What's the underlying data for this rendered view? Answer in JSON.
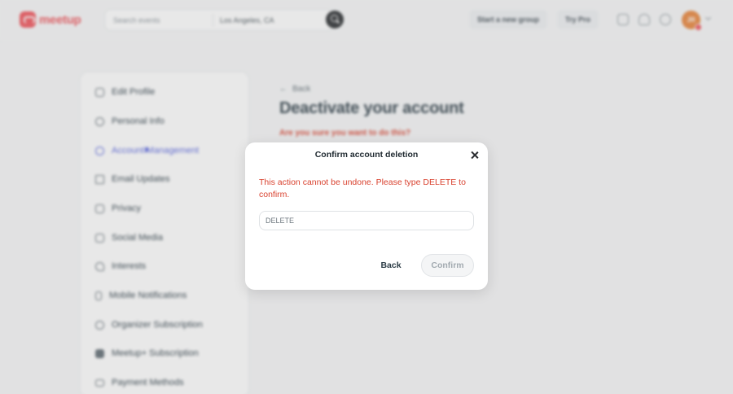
{
  "header": {
    "logo_text": "meetup",
    "search_placeholder": "Search events",
    "location": "Los Angeles, CA",
    "start_group_label": "Start a new group",
    "try_pro_label": "Try Pro",
    "avatar_initials": "JR"
  },
  "sidebar": {
    "items": [
      {
        "label": "Edit Profile",
        "icon": "profile-icon"
      },
      {
        "label": "Personal Info",
        "icon": "info-icon"
      },
      {
        "label": "Account Management",
        "icon": "gear-icon",
        "active": true
      },
      {
        "label": "Email Updates",
        "icon": "mail-icon"
      },
      {
        "label": "Privacy",
        "icon": "lock-icon"
      },
      {
        "label": "Social Media",
        "icon": "share-icon"
      },
      {
        "label": "Interests",
        "icon": "heart-icon"
      },
      {
        "label": "Mobile Notifications",
        "icon": "phone-icon"
      },
      {
        "label": "Organizer Subscription",
        "icon": "people-icon"
      },
      {
        "label": "Meetup+ Subscription",
        "icon": "plus-icon"
      },
      {
        "label": "Payment Methods",
        "icon": "card-icon"
      }
    ]
  },
  "main": {
    "back_label": "Back",
    "title": "Deactivate your account",
    "warning": "Are you sure you want to do this?"
  },
  "modal": {
    "title": "Confirm account deletion",
    "message": "This action cannot be undone. Please type DELETE to confirm.",
    "input_placeholder": "DELETE",
    "input_value": "",
    "back_label": "Back",
    "confirm_label": "Confirm"
  },
  "colors": {
    "brand": "#f0535a",
    "accent": "#5865e0",
    "danger": "#d9422f"
  }
}
